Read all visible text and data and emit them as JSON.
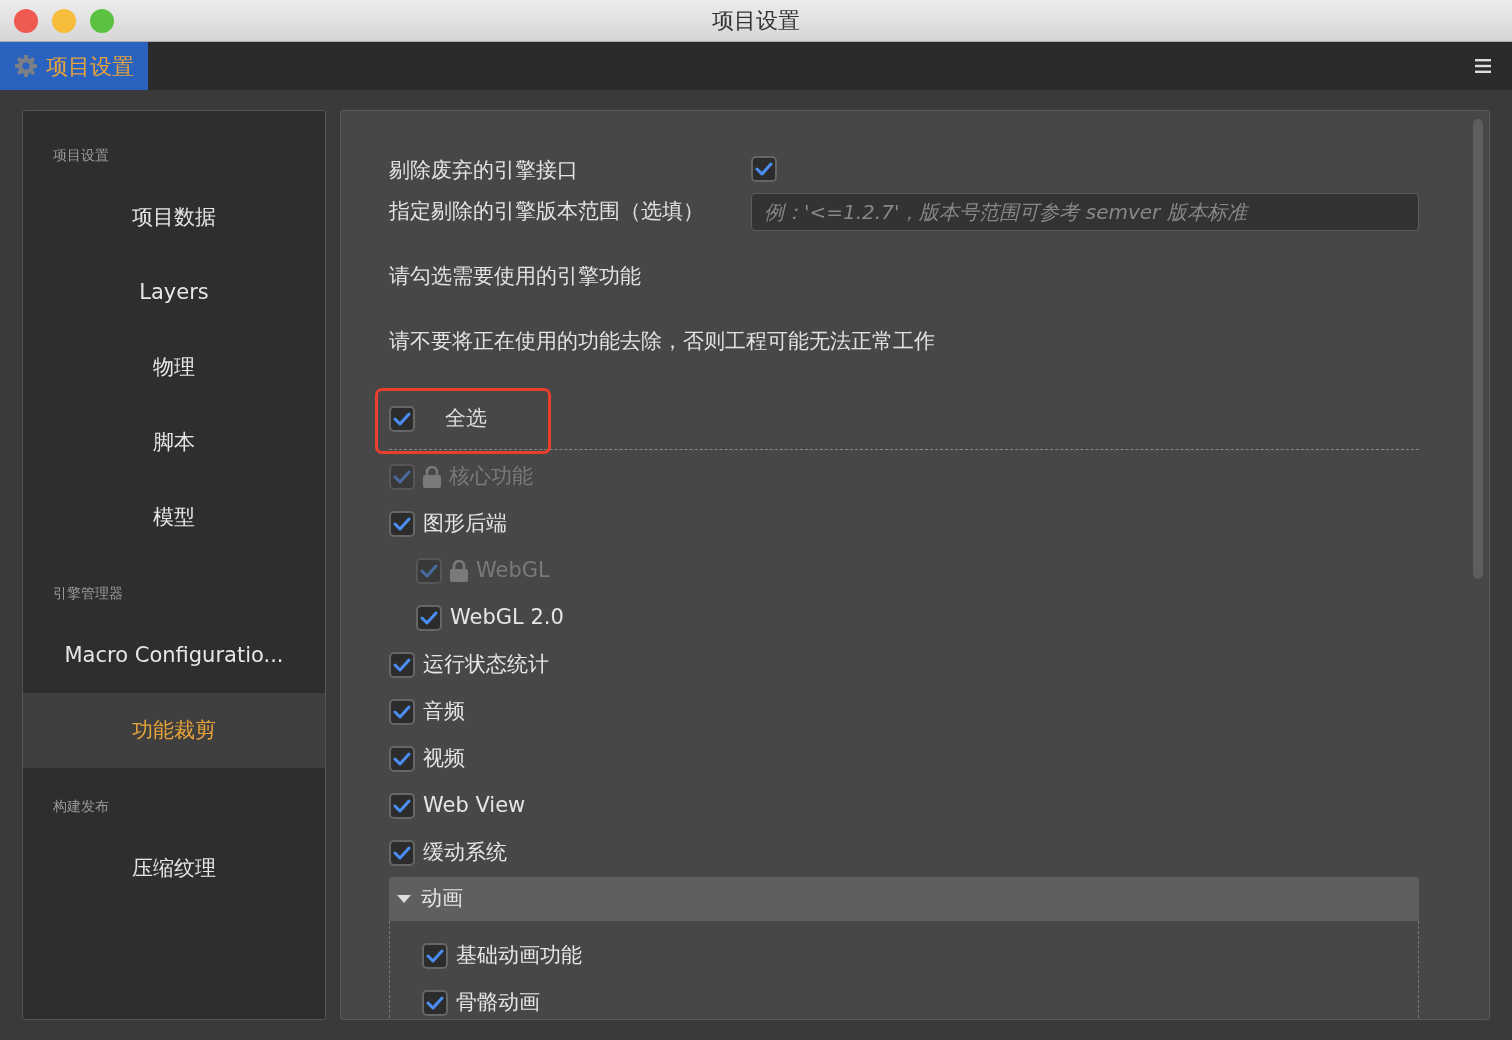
{
  "window": {
    "title": "项目设置"
  },
  "tab": {
    "label": "项目设置",
    "selected": true
  },
  "sidebar": {
    "sections": [
      {
        "heading": "项目设置",
        "items": [
          {
            "label": "项目数据",
            "selected": false
          },
          {
            "label": "Layers",
            "selected": false
          },
          {
            "label": "物理",
            "selected": false
          },
          {
            "label": "脚本",
            "selected": false
          },
          {
            "label": "模型",
            "selected": false
          }
        ]
      },
      {
        "heading": "引擎管理器",
        "items": [
          {
            "label": "Macro Configuratio...",
            "selected": false
          },
          {
            "label": "功能裁剪",
            "selected": true
          }
        ]
      },
      {
        "heading": "构建发布",
        "items": [
          {
            "label": "压缩纹理",
            "selected": false
          }
        ]
      }
    ]
  },
  "settings": {
    "strip_deprecated": {
      "label": "剔除废弃的引擎接口",
      "checked": true
    },
    "version_range": {
      "label": "指定剔除的引擎版本范围（选填）",
      "placeholder": "例：'<=1.2.7'，版本号范围可参考 semver 版本标准"
    },
    "hints": [
      "请勾选需要使用的引擎功能",
      "请不要将正在使用的功能去除，否则工程可能无法正常工作"
    ]
  },
  "features": {
    "select_all": {
      "label": "全选",
      "checked": true,
      "highlighted": true
    },
    "items": [
      {
        "label": "核心功能",
        "checked": true,
        "locked": true
      },
      {
        "label": "图形后端",
        "checked": true,
        "locked": false,
        "children": [
          {
            "label": "WebGL",
            "checked": true,
            "locked": true
          },
          {
            "label": "WebGL 2.0",
            "checked": true,
            "locked": false
          }
        ]
      },
      {
        "label": "运行状态统计",
        "checked": true,
        "locked": false
      },
      {
        "label": "音频",
        "checked": true,
        "locked": false
      },
      {
        "label": "视频",
        "checked": true,
        "locked": false
      },
      {
        "label": "Web View",
        "checked": true,
        "locked": false
      },
      {
        "label": "缓动系统",
        "checked": true,
        "locked": false
      }
    ],
    "group": {
      "label": "动画",
      "expanded": true,
      "items": [
        {
          "label": "基础动画功能",
          "checked": true,
          "locked": false
        },
        {
          "label": "骨骼动画",
          "checked": true,
          "locked": false
        }
      ]
    }
  }
}
